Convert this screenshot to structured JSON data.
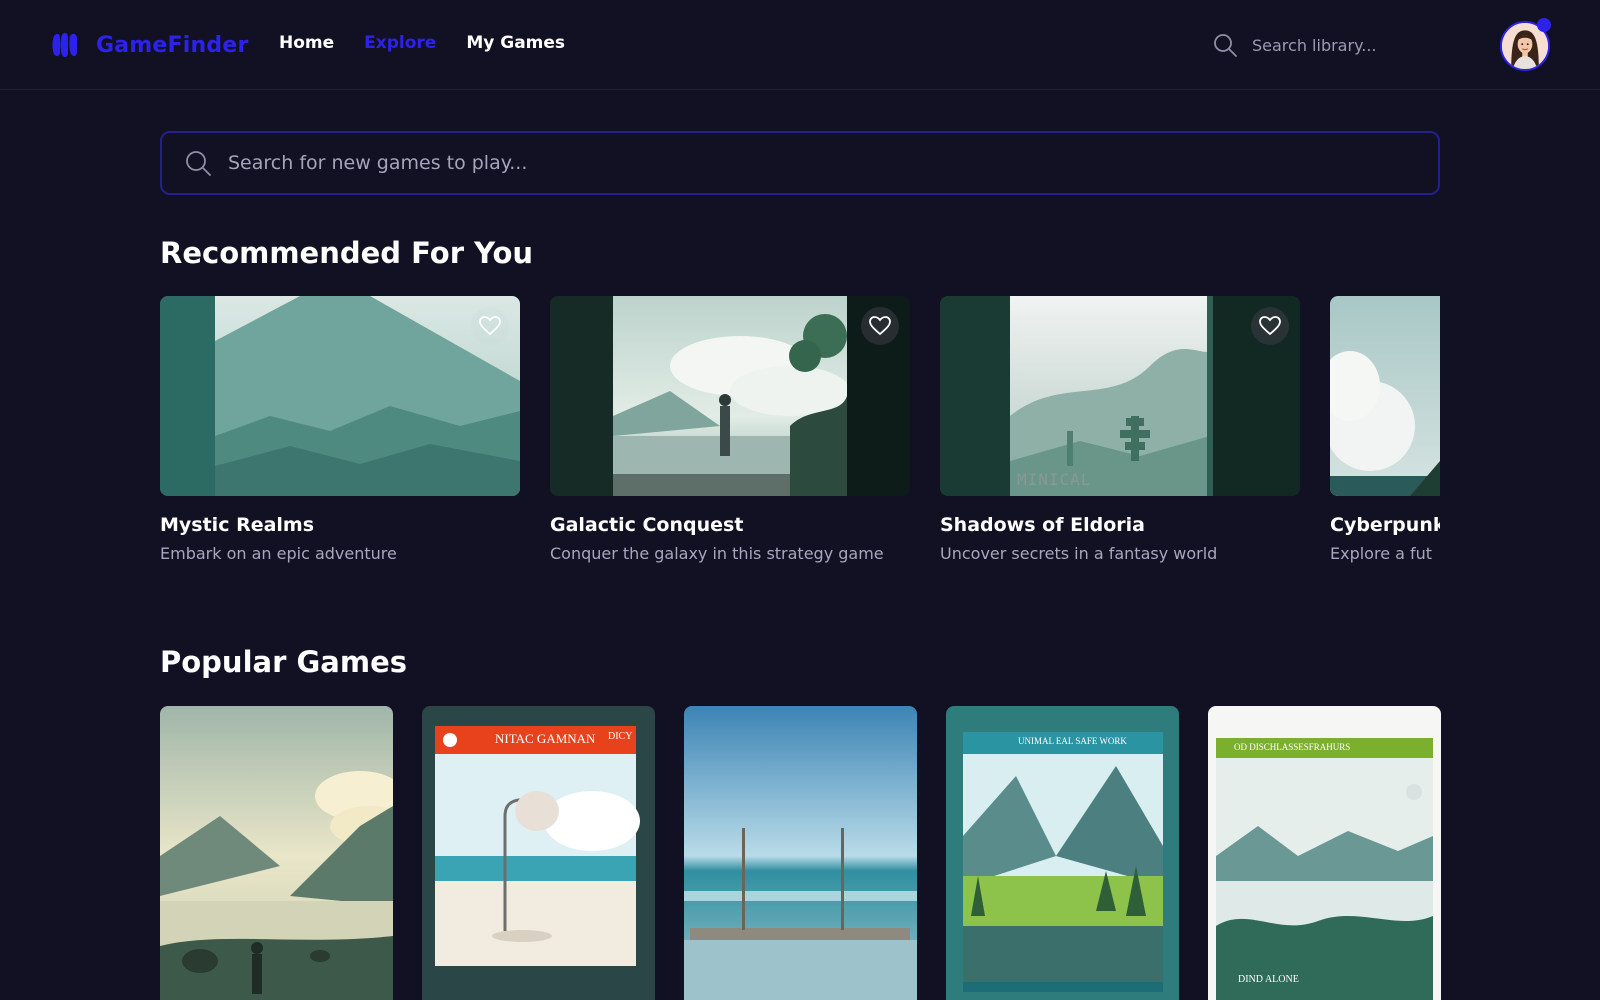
{
  "app": {
    "name": "GameFinder",
    "brand_color": "#2c22ec",
    "background": "#121124"
  },
  "nav": {
    "links": [
      {
        "label": "Home",
        "active": false
      },
      {
        "label": "Explore",
        "active": true
      },
      {
        "label": "My Games",
        "active": false
      }
    ]
  },
  "library_search": {
    "placeholder": "Search library...",
    "icon": "search-icon"
  },
  "user": {
    "avatar_icon": "user-avatar",
    "has_notification": true
  },
  "main_search": {
    "placeholder": "Search for new games to play...",
    "icon": "search-icon"
  },
  "recommended": {
    "title": "Recommended For You",
    "games": [
      {
        "title": "Mystic Realms",
        "description": "Embark on an epic adventure",
        "icon": "heart-icon"
      },
      {
        "title": "Galactic Conquest",
        "description": "Conquer the galaxy in this strategy game",
        "icon": "heart-icon"
      },
      {
        "title": "Shadows of Eldoria",
        "description": "Uncover secrets in a fantasy world",
        "icon": "heart-icon"
      },
      {
        "title": "Cyberpunk",
        "description": "Explore a fut",
        "icon": "heart-icon"
      }
    ],
    "cover_text": {
      "shadows_of_eldoria": "MINICAL"
    }
  },
  "popular": {
    "title": "Popular Games",
    "covers": [
      {
        "art": "lake-silhouette"
      },
      {
        "art": "beach-lamp",
        "banner": "NITAC GAMNAN",
        "corner": "DICY"
      },
      {
        "art": "ocean-pier"
      },
      {
        "art": "mountain-valley",
        "banner": "UNIMAL EAL SAFE WORK"
      },
      {
        "art": "misty-lake",
        "banner": "OD DISCHLASSESFRAHURS",
        "footer": "DIND ALONE"
      }
    ]
  }
}
